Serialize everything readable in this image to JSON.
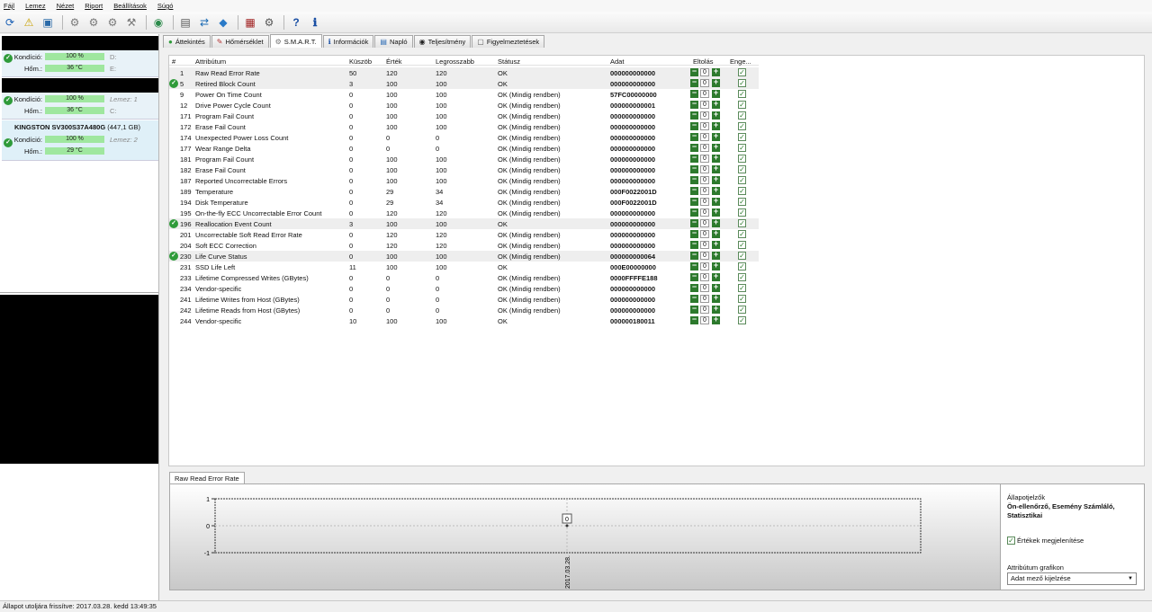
{
  "menu": [
    "Fájl",
    "Lemez",
    "Nézet",
    "Riport",
    "Beállítások",
    "Súgó"
  ],
  "disks": [
    {
      "condition_label": "Kondíció:",
      "condition": "100 %",
      "temp_label": "Hőm.:",
      "temp": "36 °C",
      "letter1": "D:",
      "letter2": "E:"
    },
    {
      "condition_label": "Kondíció:",
      "condition": "100 %",
      "temp_label": "Hőm.:",
      "temp": "36 °C",
      "letter1": "Lemez: 1",
      "letter2": "C:"
    },
    {
      "name": "KINGSTON SV300S37A480G",
      "size": "(447,1 GB)",
      "condition_label": "Kondíció:",
      "condition": "100 %",
      "temp_label": "Hőm.:",
      "temp": "29 °C",
      "letter1": "Lemez: 2"
    }
  ],
  "tabs": [
    "Áttekintés",
    "Hőmérséklet",
    "S.M.A.R.T.",
    "Információk",
    "Napló",
    "Teljesítmény",
    "Figyelmeztetések"
  ],
  "columns": {
    "num": "#",
    "attr": "Attribútum",
    "thr": "Küszöb",
    "val": "Érték",
    "worst": "Legrosszabb",
    "status": "Státusz",
    "data": "Adat",
    "offset": "Eltolás",
    "enable": "Enge..."
  },
  "rows": [
    {
      "id": "1",
      "name": "Raw Read Error Rate",
      "thr": "50",
      "val": "120",
      "worst": "120",
      "status": "OK",
      "data": "000000000000",
      "offset": "0",
      "ok": false,
      "hl": true
    },
    {
      "id": "5",
      "name": "Retired Block Count",
      "thr": "3",
      "val": "100",
      "worst": "100",
      "status": "OK",
      "data": "000000000000",
      "offset": "0",
      "ok": true,
      "hl": true
    },
    {
      "id": "9",
      "name": "Power On Time Count",
      "thr": "0",
      "val": "100",
      "worst": "100",
      "status": "OK (Mindig rendben)",
      "data": "57FC00000000",
      "offset": "0",
      "ok": false,
      "hl": false
    },
    {
      "id": "12",
      "name": "Drive Power Cycle Count",
      "thr": "0",
      "val": "100",
      "worst": "100",
      "status": "OK (Mindig rendben)",
      "data": "000000000001",
      "offset": "0",
      "ok": false,
      "hl": false
    },
    {
      "id": "171",
      "name": "Program Fail Count",
      "thr": "0",
      "val": "100",
      "worst": "100",
      "status": "OK (Mindig rendben)",
      "data": "000000000000",
      "offset": "0",
      "ok": false,
      "hl": false
    },
    {
      "id": "172",
      "name": "Erase Fail Count",
      "thr": "0",
      "val": "100",
      "worst": "100",
      "status": "OK (Mindig rendben)",
      "data": "000000000000",
      "offset": "0",
      "ok": false,
      "hl": false
    },
    {
      "id": "174",
      "name": "Unexpected Power Loss Count",
      "thr": "0",
      "val": "0",
      "worst": "0",
      "status": "OK (Mindig rendben)",
      "data": "000000000000",
      "offset": "0",
      "ok": false,
      "hl": false
    },
    {
      "id": "177",
      "name": "Wear Range Delta",
      "thr": "0",
      "val": "0",
      "worst": "0",
      "status": "OK (Mindig rendben)",
      "data": "000000000000",
      "offset": "0",
      "ok": false,
      "hl": false
    },
    {
      "id": "181",
      "name": "Program Fail Count",
      "thr": "0",
      "val": "100",
      "worst": "100",
      "status": "OK (Mindig rendben)",
      "data": "000000000000",
      "offset": "0",
      "ok": false,
      "hl": false
    },
    {
      "id": "182",
      "name": "Erase Fail Count",
      "thr": "0",
      "val": "100",
      "worst": "100",
      "status": "OK (Mindig rendben)",
      "data": "000000000000",
      "offset": "0",
      "ok": false,
      "hl": false
    },
    {
      "id": "187",
      "name": "Reported Uncorrectable Errors",
      "thr": "0",
      "val": "100",
      "worst": "100",
      "status": "OK (Mindig rendben)",
      "data": "000000000000",
      "offset": "0",
      "ok": false,
      "hl": false
    },
    {
      "id": "189",
      "name": "Temperature",
      "thr": "0",
      "val": "29",
      "worst": "34",
      "status": "OK (Mindig rendben)",
      "data": "000F0022001D",
      "offset": "0",
      "ok": false,
      "hl": false
    },
    {
      "id": "194",
      "name": "Disk Temperature",
      "thr": "0",
      "val": "29",
      "worst": "34",
      "status": "OK (Mindig rendben)",
      "data": "000F0022001D",
      "offset": "0",
      "ok": false,
      "hl": false
    },
    {
      "id": "195",
      "name": "On-the-fly ECC Uncorrectable Error Count",
      "thr": "0",
      "val": "120",
      "worst": "120",
      "status": "OK (Mindig rendben)",
      "data": "000000000000",
      "offset": "0",
      "ok": false,
      "hl": false
    },
    {
      "id": "196",
      "name": "Reallocation Event Count",
      "thr": "3",
      "val": "100",
      "worst": "100",
      "status": "OK",
      "data": "000000000000",
      "offset": "0",
      "ok": true,
      "hl": true
    },
    {
      "id": "201",
      "name": "Uncorrectable Soft Read Error Rate",
      "thr": "0",
      "val": "120",
      "worst": "120",
      "status": "OK (Mindig rendben)",
      "data": "000000000000",
      "offset": "0",
      "ok": false,
      "hl": false
    },
    {
      "id": "204",
      "name": "Soft ECC Correction",
      "thr": "0",
      "val": "120",
      "worst": "120",
      "status": "OK (Mindig rendben)",
      "data": "000000000000",
      "offset": "0",
      "ok": false,
      "hl": false
    },
    {
      "id": "230",
      "name": "Life Curve Status",
      "thr": "0",
      "val": "100",
      "worst": "100",
      "status": "OK (Mindig rendben)",
      "data": "000000000064",
      "offset": "0",
      "ok": true,
      "hl": true
    },
    {
      "id": "231",
      "name": "SSD Life Left",
      "thr": "11",
      "val": "100",
      "worst": "100",
      "status": "OK",
      "data": "000E00000000",
      "offset": "0",
      "ok": false,
      "hl": false
    },
    {
      "id": "233",
      "name": "Lifetime Compressed Writes (GBytes)",
      "thr": "0",
      "val": "0",
      "worst": "0",
      "status": "OK (Mindig rendben)",
      "data": "0000FFFFE188",
      "offset": "0",
      "ok": false,
      "hl": false
    },
    {
      "id": "234",
      "name": "Vendor-specific",
      "thr": "0",
      "val": "0",
      "worst": "0",
      "status": "OK (Mindig rendben)",
      "data": "000000000000",
      "offset": "0",
      "ok": false,
      "hl": false
    },
    {
      "id": "241",
      "name": "Lifetime Writes from Host (GBytes)",
      "thr": "0",
      "val": "0",
      "worst": "0",
      "status": "OK (Mindig rendben)",
      "data": "000000000000",
      "offset": "0",
      "ok": false,
      "hl": false
    },
    {
      "id": "242",
      "name": "Lifetime Reads from Host (GBytes)",
      "thr": "0",
      "val": "0",
      "worst": "0",
      "status": "OK (Mindig rendben)",
      "data": "000000000000",
      "offset": "0",
      "ok": false,
      "hl": false
    },
    {
      "id": "244",
      "name": "Vendor-specific",
      "thr": "10",
      "val": "100",
      "worst": "100",
      "status": "OK",
      "data": "000000180011",
      "offset": "0",
      "ok": false,
      "hl": false
    }
  ],
  "graph_tab": "Raw Read Error Rate",
  "graph": {
    "y_ticks": [
      "1",
      "0",
      "-1"
    ],
    "point_label": "0",
    "x_label": "2017.03.28."
  },
  "right_panel": {
    "title": "Állapotjelzők",
    "desc": "Ön-ellenőrző, Esemény Számláló, Statisztikai",
    "show_values": "Értékek megjelenítése",
    "attr_graph": "Attribútum grafikon",
    "select": "Adat mező kijelzése"
  },
  "status_bar": "Állapot utoljára frissítve: 2017.03.28. kedd 13:49:35"
}
